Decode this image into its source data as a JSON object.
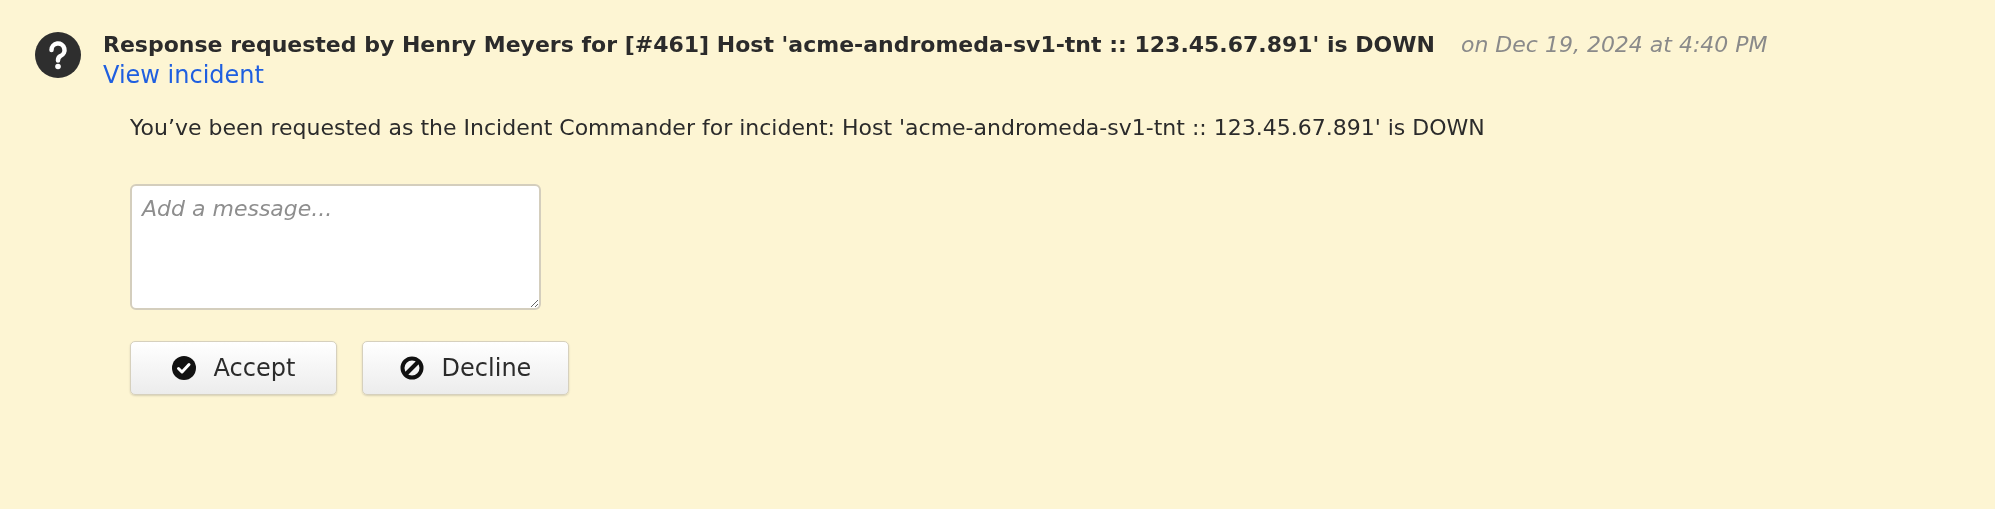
{
  "notification": {
    "title": "Response requested by Henry Meyers for [#461] Host 'acme-andromeda-sv1-tnt :: 123.45.67.891' is DOWN",
    "timestamp": "on Dec 19, 2024 at 4:40 PM",
    "link": "View incident",
    "message": "You’ve been requested as the Incident Commander for incident: Host 'acme-andromeda-sv1-tnt :: 123.45.67.891' is DOWN",
    "reply": {
      "placeholder": "Add a message..."
    },
    "buttons": [
      {
        "kind": "accept",
        "label": "Accept"
      },
      {
        "kind": "decline",
        "label": "Decline"
      }
    ]
  }
}
